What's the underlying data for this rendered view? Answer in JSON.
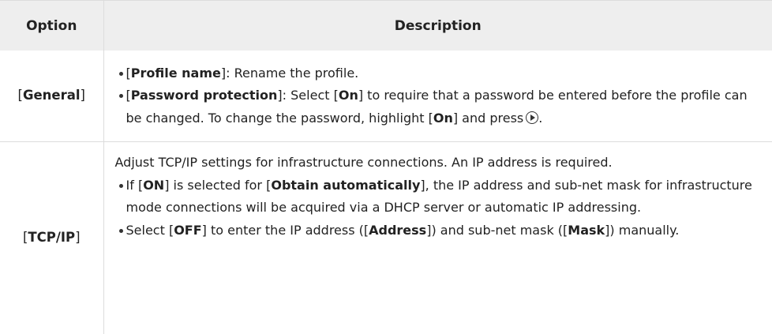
{
  "header": {
    "option": "Option",
    "description": "Description"
  },
  "rows": {
    "general": {
      "option_name": "General",
      "items": [
        {
          "term": "Profile name",
          "text": ": Rename the profile."
        },
        {
          "term": "Password protection",
          "text1": ": Select [",
          "on1": "On",
          "text2": "] to require that a password be entered before the profile can be changed. To change the password, highlight [",
          "on2": "On",
          "text3": "] and press",
          "icon": "multi-selector-right-icon",
          "text4": "."
        }
      ]
    },
    "tcpip": {
      "option_name": "TCP/IP",
      "intro": "Adjust TCP/IP settings for infrastructure connections. An IP address is required.",
      "items": [
        {
          "pre": "If [",
          "val": "ON",
          "mid": "] is selected for [",
          "term": "Obtain automatically",
          "post": "], the IP address and sub-net mask for infrastructure mode connections will be acquired via a DHCP server or automatic IP addressing."
        },
        {
          "pre": "Select [",
          "val": "OFF",
          "mid": "] to enter the IP address ([",
          "term1": "Address",
          "mid2": "]) and sub-net mask ([",
          "term2": "Mask",
          "post": "]) manually."
        }
      ]
    }
  }
}
